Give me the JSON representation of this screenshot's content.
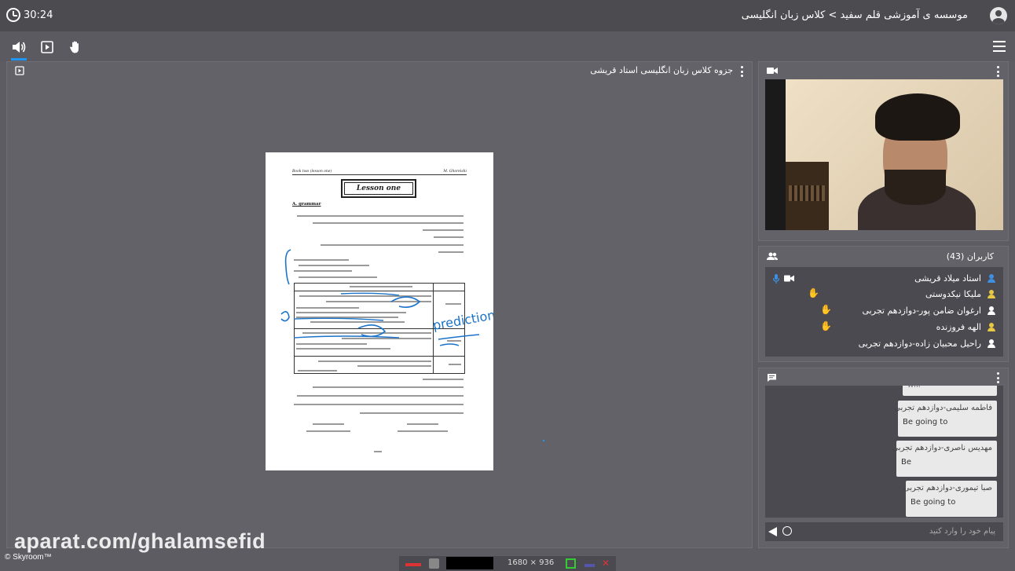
{
  "header": {
    "timer": "30:24",
    "title": "موسسه ی آموزشی قلم سفید > کلاس زبان انگلیسی"
  },
  "presentation": {
    "title": "جزوه کلاس زبان انگلیسی استاد قریشی",
    "document": {
      "header_left": "Book two (lesson one)",
      "header_right": "M. Ghoreishi",
      "title": "Lesson one",
      "section": "A. grammar",
      "handwriting": "prediction"
    }
  },
  "users": {
    "title": "کاربران (43)",
    "list": [
      {
        "name": "استاد میلاد قریشی",
        "icon_color": "#3d8fe0",
        "mic": true,
        "camera": true,
        "hand": false
      },
      {
        "name": "ملیکا نیکدوستی",
        "icon_color": "#e8c840",
        "mic": false,
        "camera": false,
        "hand": true
      },
      {
        "name": "ارغوان ضامن پور-دوازدهم تجربی",
        "icon_color": "#ffffff",
        "mic": false,
        "camera": false,
        "hand": true
      },
      {
        "name": "الهه فروزنده",
        "icon_color": "#e8c840",
        "mic": false,
        "camera": false,
        "hand": true
      },
      {
        "name": "راحیل محبیان زاده-دوازدهم تجربی",
        "icon_color": "#ffffff",
        "mic": false,
        "camera": false,
        "hand": false
      }
    ]
  },
  "chat": {
    "messages": [
      {
        "sender": "",
        "text": "will"
      },
      {
        "sender": "فاطمه سلیمی-دوازدهم تجربی",
        "text": "Be going to"
      },
      {
        "sender": "مهدیس ناصری-دوازدهم تجربی",
        "text": "Be"
      },
      {
        "sender": "صبا تیموری-دوازدهم تجربی",
        "text": "Be going to"
      }
    ],
    "placeholder": "پیام خود را وارد کنید"
  },
  "footer": {
    "watermark": "aparat.com/ghalamsefid",
    "brand": "© Skyroom™",
    "resolution": "1680 × 936"
  },
  "colors": {
    "accent": "#2196f3",
    "ink": "#1a73c9"
  },
  "icons": [
    "clock-icon",
    "avatar-icon",
    "speaker-icon",
    "screen-share-icon",
    "raise-hand-icon",
    "menu-icon",
    "camera-icon",
    "users-icon",
    "chat-icon",
    "mic-icon",
    "send-icon",
    "emoji-icon"
  ]
}
